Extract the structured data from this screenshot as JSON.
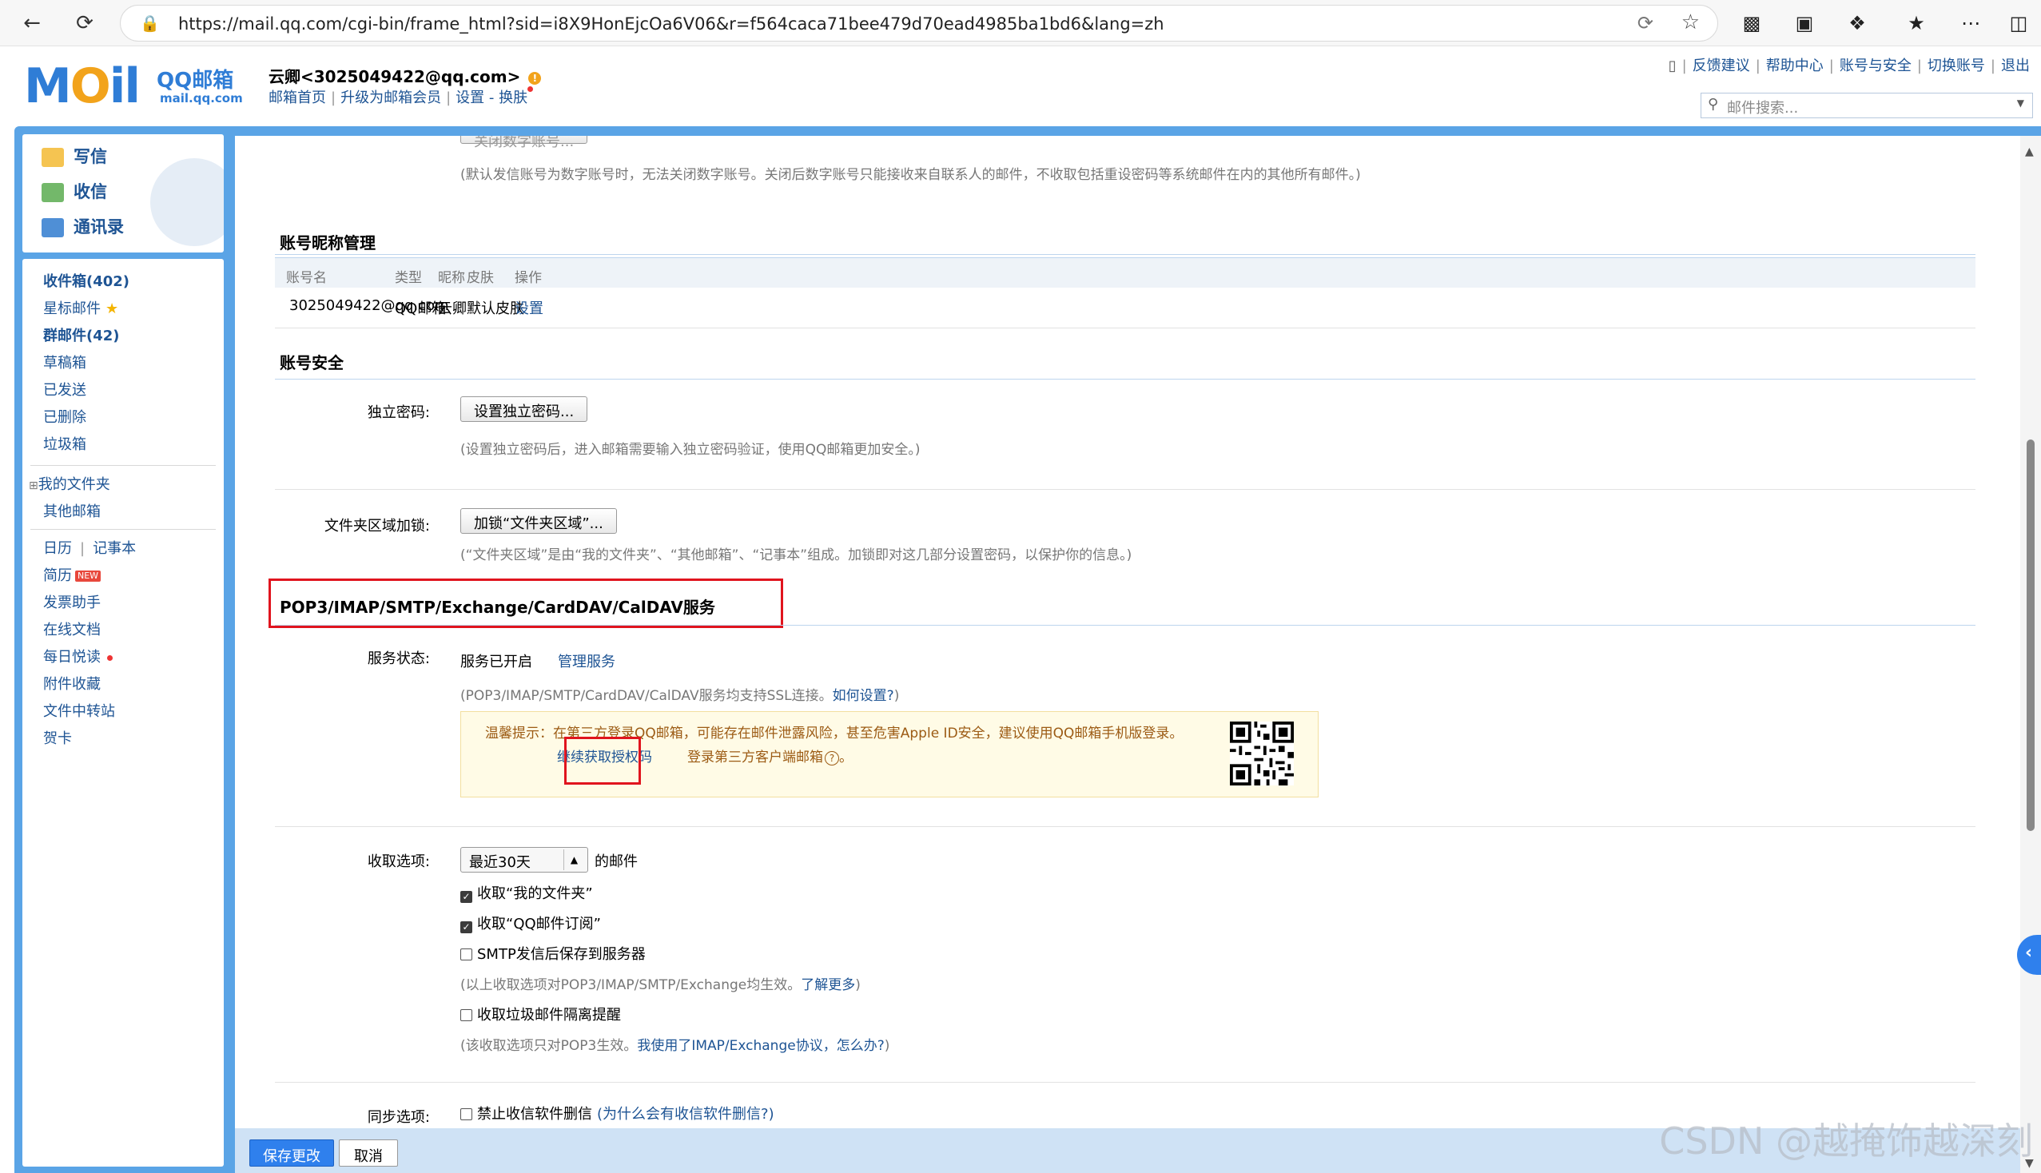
{
  "browser": {
    "url": "https://mail.qq.com/cgi-bin/frame_html?sid=i8X9HonEjcOa6V06&r=f564caca71bee479d70ead4985ba1bd6&lang=zh"
  },
  "header": {
    "logo_text": "MOil",
    "logo_cn": "QQ邮箱",
    "logo_domain": "mail.qq.com",
    "user": "云卿<3025049422@qq.com>",
    "links": [
      "邮箱首页",
      "升级为邮箱会员",
      "设置",
      "换肤"
    ],
    "top_links": [
      "反馈建议",
      "帮助中心",
      "账号与安全",
      "切换账号",
      "退出"
    ],
    "search_placeholder": "邮件搜索..."
  },
  "quick_actions": [
    "写信",
    "收信",
    "通讯录"
  ],
  "folders": [
    {
      "label": "收件箱(402)",
      "bold": true
    },
    {
      "label": "星标邮件",
      "star": true
    },
    {
      "label": "群邮件(42)",
      "bold": true
    },
    {
      "label": "草稿箱"
    },
    {
      "label": "已发送"
    },
    {
      "label": "已删除"
    },
    {
      "label": "垃圾箱"
    }
  ],
  "folders2": [
    "我的文件夹",
    "其他邮箱"
  ],
  "apps": {
    "calendar": "日历",
    "notes": "记事本",
    "resume": "简历",
    "new_badge": "NEW",
    "invoice": "发票助手",
    "docs": "在线文档",
    "daily": "每日悦读",
    "attach": "附件收藏",
    "transfer": "文件中转站",
    "card": "贺卡"
  },
  "content": {
    "top_note": "(默认发信账号为数字账号时，无法关闭数字账号。关闭后数字账号只能接收来自联系人的邮件，不收取包括重设密码等系统邮件在内的其他所有邮件。)",
    "nickname_section": {
      "title": "账号昵称管理",
      "columns": [
        "账号名",
        "类型",
        "昵称",
        "皮肤",
        "操作"
      ],
      "row": [
        "3025049422@qq.com",
        "QQ邮箱",
        "云卿",
        "默认皮肤",
        "设置"
      ]
    },
    "security_section": {
      "title": "账号安全",
      "pwd_label": "独立密码:",
      "pwd_button": "设置独立密码...",
      "pwd_note": "(设置独立密码后，进入邮箱需要输入独立密码验证，使用QQ邮箱更加安全。)",
      "lock_label": "文件夹区域加锁:",
      "lock_button": "加锁“文件夹区域”...",
      "lock_note": "(“文件夹区域”是由“我的文件夹”、“其他邮箱”、“记事本”组成。加锁即对这几部分设置密码，以保护你的信息。)"
    },
    "service_section": {
      "title": "POP3/IMAP/SMTP/Exchange/CardDAV/CalDAV服务",
      "status_label": "服务状态:",
      "status_value": "服务已开启",
      "manage_link": "管理服务",
      "ssl_note": "(POP3/IMAP/SMTP/CardDAV/CalDAV服务均支持SSL连接。",
      "ssl_link": "如何设置?",
      "ssl_end": ")",
      "tip_text": "温馨提示：在第三方登录QQ邮箱，可能存在邮件泄露风险，甚至危害Apple ID安全，建议使用QQ邮箱手机版登录。",
      "tip_link": "继续获取授权码",
      "tip_link_after": "登录第三方客户端邮箱",
      "tip_help": "?",
      "tip_end": "。"
    },
    "receive": {
      "label": "收取选项:",
      "select_value": "最近30天",
      "select_suffix": "的邮件",
      "opt1": "收取“我的文件夹”",
      "opt2": "收取“QQ邮件订阅”",
      "opt3": "SMTP发信后保存到服务器",
      "note1": "(以上收取选项对POP3/IMAP/SMTP/Exchange均生效。",
      "note1_link": "了解更多",
      "note1_end": ")",
      "opt4": "收取垃圾邮件隔离提醒",
      "note2": "(该收取选项只对POP3生效。",
      "note2_link": "我使用了IMAP/Exchange协议，怎么办?",
      "note2_end": ")"
    },
    "sync": {
      "label": "同步选项:",
      "opt": "禁止收信软件删信",
      "link": "(为什么会有收信软件删信?)"
    }
  },
  "footer": {
    "save": "保存更改",
    "cancel": "取消",
    "watermark": "CSDN @越掩饰越深刻"
  },
  "colors": {
    "accent": "#2f80ed",
    "link": "#1e5494",
    "frame": "#5aa4e6",
    "highlight_red": "#e0141e"
  }
}
